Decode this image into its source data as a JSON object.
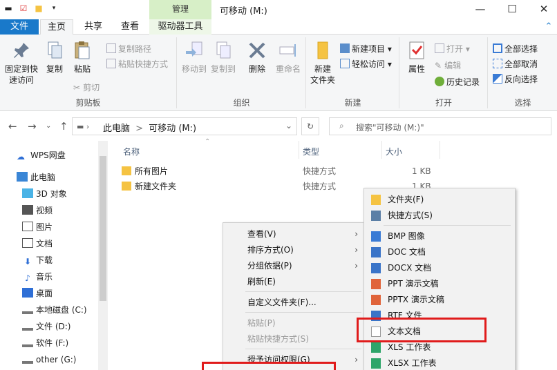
{
  "window": {
    "title": "可移动 (M:)",
    "manage_tab": "管理",
    "minimize": "—",
    "maximize": "☐",
    "close": "✕"
  },
  "tabs": {
    "file": "文件",
    "home": "主页",
    "share": "共享",
    "view": "查看",
    "drive_tools": "驱动器工具",
    "collapse": "⌃"
  },
  "ribbon": {
    "clipboard": {
      "label": "剪贴板",
      "pin": "固定到快\n速访问",
      "copy": "复制",
      "paste": "粘贴",
      "copy_path": "复制路径",
      "paste_shortcut": "粘贴快捷方式",
      "cut": "剪切"
    },
    "organize": {
      "label": "组织",
      "move_to": "移动到",
      "copy_to": "复制到",
      "delete": "删除",
      "rename": "重命名"
    },
    "new": {
      "label": "新建",
      "new_folder": "新建\n文件夹",
      "new_item": "新建项目",
      "easy_access": "轻松访问"
    },
    "open": {
      "label": "打开",
      "properties": "属性",
      "open": "打开",
      "edit": "编辑",
      "history": "历史记录"
    },
    "select": {
      "label": "选择",
      "select_all": "全部选择",
      "select_none": "全部取消",
      "invert": "反向选择"
    }
  },
  "address": {
    "path_pc": "此电脑",
    "path_sep": ">",
    "path_drive": "可移动 (M:)",
    "search_placeholder": "搜索\"可移动 (M:)\""
  },
  "nav": {
    "items": [
      {
        "label": "WPS网盘",
        "icon": "cloud-icon"
      },
      {
        "label": "此电脑",
        "icon": "computer-icon"
      },
      {
        "label": "3D 对象",
        "icon": "cube-icon"
      },
      {
        "label": "视频",
        "icon": "video-icon"
      },
      {
        "label": "图片",
        "icon": "picture-icon"
      },
      {
        "label": "文档",
        "icon": "document-icon"
      },
      {
        "label": "下载",
        "icon": "download-icon"
      },
      {
        "label": "音乐",
        "icon": "music-icon"
      },
      {
        "label": "桌面",
        "icon": "desktop-icon"
      },
      {
        "label": "本地磁盘 (C:)",
        "icon": "drive-icon"
      },
      {
        "label": "文件 (D:)",
        "icon": "drive-icon"
      },
      {
        "label": "软件 (F:)",
        "icon": "drive-icon"
      },
      {
        "label": "other (G:)",
        "icon": "drive-icon"
      }
    ]
  },
  "columns": {
    "name": "名称",
    "type": "类型",
    "size": "大小"
  },
  "files": [
    {
      "name": "所有图片",
      "type": "快捷方式",
      "size": "1 KB"
    },
    {
      "name": "新建文件夹",
      "type": "快捷方式",
      "size": "1 KB"
    }
  ],
  "context_menu": {
    "view": "查看(V)",
    "sort": "排序方式(O)",
    "group": "分组依据(P)",
    "refresh": "刷新(E)",
    "customize": "自定义文件夹(F)...",
    "paste": "粘贴(P)",
    "paste_shortcut": "粘贴快捷方式(S)",
    "grant_access": "授予访问权限(G)"
  },
  "submenu": {
    "items": [
      {
        "label": "文件夹(F)",
        "icon": "folder-icon",
        "color": "#f5c342"
      },
      {
        "label": "快捷方式(S)",
        "icon": "shortcut-icon",
        "color": "#5b7fa6"
      },
      {
        "label": "BMP 图像",
        "icon": "bmp-icon",
        "color": "#3a7bd5"
      },
      {
        "label": "DOC 文档",
        "icon": "doc-icon",
        "color": "#3a74c8"
      },
      {
        "label": "DOCX 文档",
        "icon": "docx-icon",
        "color": "#3a74c8"
      },
      {
        "label": "PPT 演示文稿",
        "icon": "ppt-icon",
        "color": "#e0643a"
      },
      {
        "label": "PPTX 演示文稿",
        "icon": "pptx-icon",
        "color": "#e0643a"
      },
      {
        "label": "RTF 文件",
        "icon": "rtf-icon",
        "color": "#3a74c8"
      },
      {
        "label": "文本文档",
        "icon": "text-icon",
        "color": "#9a9a9a"
      },
      {
        "label": "XLS 工作表",
        "icon": "xls-icon",
        "color": "#2ea56a"
      },
      {
        "label": "XLSX 工作表",
        "icon": "xlsx-icon",
        "color": "#2ea56a"
      }
    ]
  },
  "colors": {
    "file_tab": "#1979ca",
    "manage_tab": "#d7efc7",
    "highlight": "#e01b1b"
  }
}
